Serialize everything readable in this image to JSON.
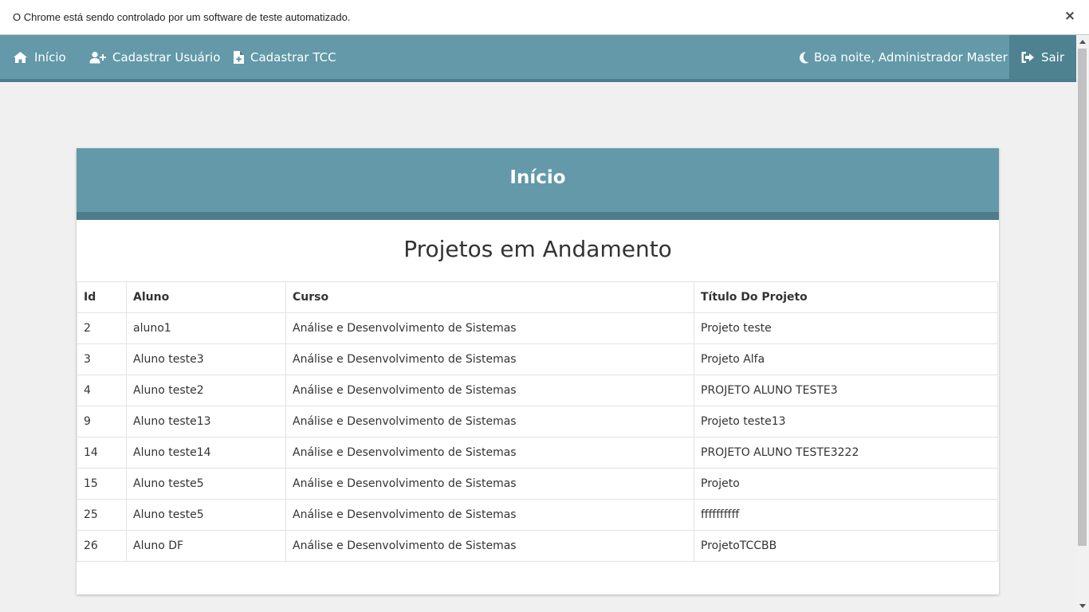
{
  "infobar": {
    "message": "O Chrome está sendo controlado por um software de teste automatizado.",
    "close_label": "×"
  },
  "navbar": {
    "home_label": "Início",
    "register_user_label": "Cadastrar Usuário",
    "register_tcc_label": "Cadastrar TCC",
    "greeting": "Boa noite, Administrador Master!",
    "logout_label": "Sair",
    "icons": {
      "home": "home-icon",
      "register_user": "user-plus-icon",
      "register_tcc": "file-plus-icon",
      "greeting": "moon-icon",
      "logout": "sign-out-icon"
    }
  },
  "card": {
    "title": "Início",
    "section_title": "Projetos em Andamento"
  },
  "table": {
    "headers": {
      "id": "Id",
      "aluno": "Aluno",
      "curso": "Curso",
      "titulo": "Título Do Projeto"
    },
    "rows": [
      {
        "id": "2",
        "aluno": "aluno1",
        "curso": "Análise e Desenvolvimento de Sistemas",
        "titulo": "Projeto teste"
      },
      {
        "id": "3",
        "aluno": "Aluno teste3",
        "curso": "Análise e Desenvolvimento de Sistemas",
        "titulo": "Projeto Alfa"
      },
      {
        "id": "4",
        "aluno": "Aluno teste2",
        "curso": "Análise e Desenvolvimento de Sistemas",
        "titulo": "PROJETO ALUNO TESTE3"
      },
      {
        "id": "9",
        "aluno": "Aluno teste13",
        "curso": "Análise e Desenvolvimento de Sistemas",
        "titulo": "Projeto teste13"
      },
      {
        "id": "14",
        "aluno": "Aluno teste14",
        "curso": "Análise e Desenvolvimento de Sistemas",
        "titulo": "PROJETO ALUNO TESTE3222"
      },
      {
        "id": "15",
        "aluno": "Aluno teste5",
        "curso": "Análise e Desenvolvimento de Sistemas",
        "titulo": "Projeto"
      },
      {
        "id": "25",
        "aluno": "Aluno teste5",
        "curso": "Análise e Desenvolvimento de Sistemas",
        "titulo": "ffffffffff"
      },
      {
        "id": "26",
        "aluno": "Aluno DF",
        "curso": "Análise e Desenvolvimento de Sistemas",
        "titulo": "ProjetoTCCBB"
      }
    ]
  },
  "colors": {
    "primary": "#6399a8",
    "primary_dark": "#4d7d8b",
    "page_bg": "#f0f0f0"
  }
}
